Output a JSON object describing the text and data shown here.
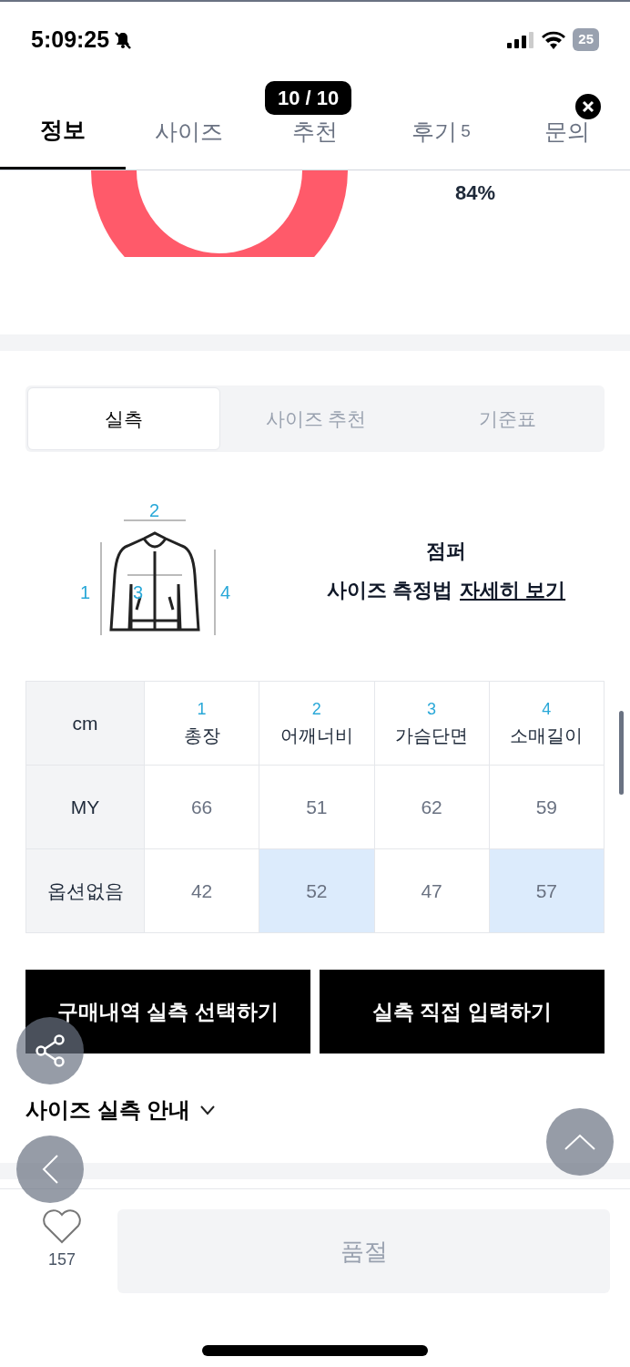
{
  "status_bar": {
    "time": "5:09:25",
    "battery": "25"
  },
  "tabs": [
    {
      "label": "정보",
      "selected": true
    },
    {
      "label": "사이즈",
      "selected": false
    },
    {
      "label": "추천",
      "selected": false
    },
    {
      "label": "후기",
      "count": "5",
      "selected": false
    },
    {
      "label": "문의",
      "selected": false
    }
  ],
  "image_counter": "10 / 10",
  "donut": {
    "percent": "84%"
  },
  "segments": [
    {
      "label": "실측",
      "selected": true
    },
    {
      "label": "사이즈 추천",
      "selected": false
    },
    {
      "label": "기준표",
      "selected": false
    }
  ],
  "diagram": {
    "marks": [
      "1",
      "2",
      "3",
      "4"
    ],
    "category": "점퍼",
    "guide": "사이즈 측정법",
    "link": "자세히 보기"
  },
  "table": {
    "corner": "cm",
    "columns": [
      {
        "number": "1",
        "name": "총장"
      },
      {
        "number": "2",
        "name": "어깨너비"
      },
      {
        "number": "3",
        "name": "가슴단면"
      },
      {
        "number": "4",
        "name": "소매길이"
      }
    ],
    "rows": [
      {
        "label": "MY",
        "cells": [
          {
            "value": "66",
            "highlighted": false
          },
          {
            "value": "51",
            "highlighted": false
          },
          {
            "value": "62",
            "highlighted": false
          },
          {
            "value": "59",
            "highlighted": false
          }
        ]
      },
      {
        "label": "옵션없음",
        "cells": [
          {
            "value": "42",
            "highlighted": false
          },
          {
            "value": "52",
            "highlighted": true
          },
          {
            "value": "47",
            "highlighted": false
          },
          {
            "value": "57",
            "highlighted": true
          }
        ]
      }
    ]
  },
  "buttons": [
    "구매내역 실측 선택하기",
    "실측 직접 입력하기"
  ],
  "guide_toggle": {
    "label": "사이즈 실측 안내",
    "expanded": false
  },
  "bottom_bar": {
    "likes": "157",
    "buy_button": "품절",
    "disabled": true
  }
}
